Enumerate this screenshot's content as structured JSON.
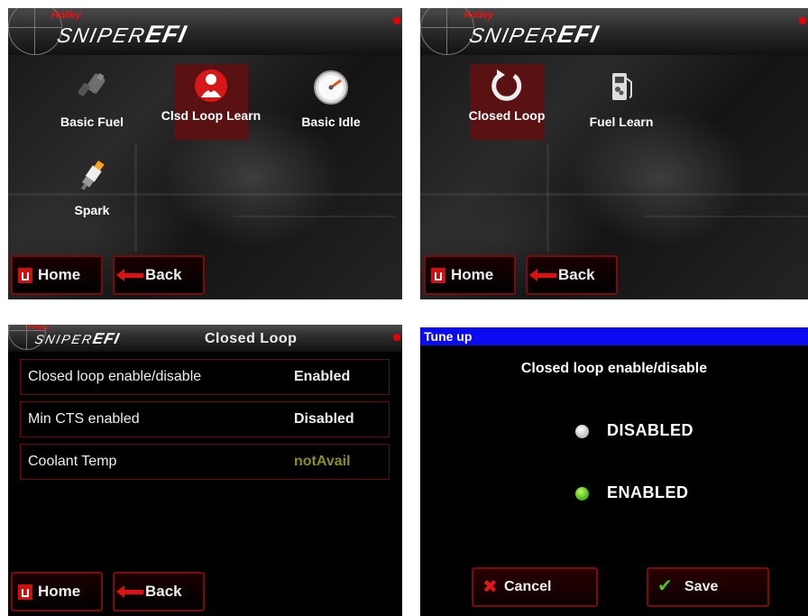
{
  "brand": {
    "maker": "Holley",
    "product_thin": "SNIPER",
    "product_bold": "EFI"
  },
  "colors": {
    "accent_red": "#7a0b0b",
    "selected_tile": "#5a1111",
    "title_bar_blue": "#0b0bf2",
    "not_avail": "#8d8d20",
    "enabled_green": "#48b010"
  },
  "screen1": {
    "tiles": [
      {
        "label": "Basic Fuel",
        "icon": "fuel-injector-icon"
      },
      {
        "label": "Clsd Loop Learn",
        "icon": "closed-loop-learn-icon"
      },
      {
        "label": "Basic Idle",
        "icon": "gauge-icon"
      },
      {
        "label": "Spark",
        "icon": "spark-plug-icon"
      }
    ],
    "home_label": "Home",
    "back_label": "Back"
  },
  "screen2": {
    "tiles": [
      {
        "label": "Closed Loop",
        "icon": "circular-arrow-icon"
      },
      {
        "label": "Fuel Learn",
        "icon": "fuel-pump-icon"
      }
    ],
    "home_label": "Home",
    "back_label": "Back"
  },
  "screen3": {
    "title": "Closed Loop",
    "rows": [
      {
        "key": "Closed loop enable/disable",
        "value": "Enabled"
      },
      {
        "key": "Min CTS enabled",
        "value": "Disabled"
      },
      {
        "key": "Coolant Temp",
        "value": "notAvail"
      }
    ],
    "home_label": "Home",
    "back_label": "Back"
  },
  "screen4": {
    "title": "Tune up",
    "prompt": "Closed loop enable/disable",
    "options": [
      {
        "label": "DISABLED",
        "selected": false
      },
      {
        "label": "ENABLED",
        "selected": true
      }
    ],
    "cancel_label": "Cancel",
    "save_label": "Save"
  }
}
